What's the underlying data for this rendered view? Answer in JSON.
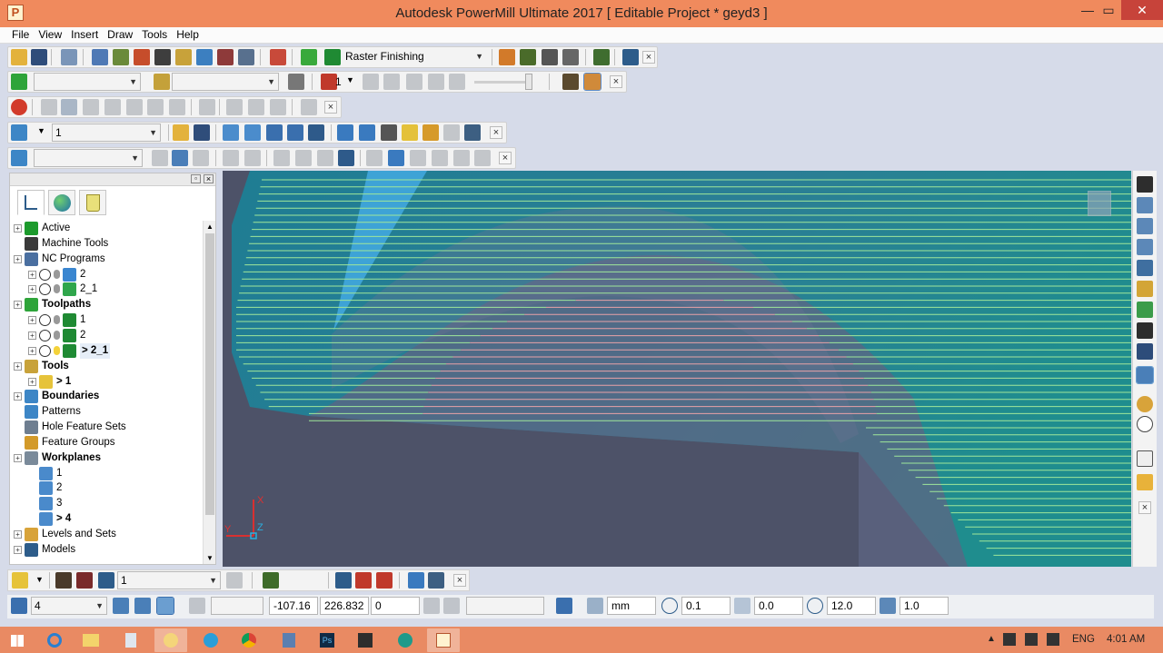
{
  "window": {
    "title": "Autodesk PowerMill Ultimate 2017    [ Editable Project * geyd3 ]",
    "app_icon_letter": "P",
    "buttons": {
      "minimize": "—",
      "maximize": "▭",
      "close": "✕"
    }
  },
  "menu": [
    "File",
    "View",
    "Insert",
    "Draw",
    "Tools",
    "Help"
  ],
  "toolbars": {
    "strategy_combo": "Raster Finishing",
    "row5_combo": "1",
    "row3_frame_value": "1"
  },
  "tree": {
    "items": [
      {
        "label": "Active",
        "bold": false
      },
      {
        "label": "Machine Tools",
        "bold": false
      },
      {
        "label": "NC Programs",
        "bold": false
      },
      {
        "label": "2",
        "bold": false
      },
      {
        "label": "2_1",
        "bold": false
      },
      {
        "label": "Toolpaths",
        "bold": true
      },
      {
        "label": "1",
        "bold": false
      },
      {
        "label": "2",
        "bold": false
      },
      {
        "label": "> 2_1",
        "bold": true
      },
      {
        "label": "Tools",
        "bold": true
      },
      {
        "label": "> 1",
        "bold": true
      },
      {
        "label": "Boundaries",
        "bold": true
      },
      {
        "label": "Patterns",
        "bold": false
      },
      {
        "label": "Hole Feature Sets",
        "bold": false
      },
      {
        "label": "Feature Groups",
        "bold": false
      },
      {
        "label": "Workplanes",
        "bold": true
      },
      {
        "label": "1",
        "bold": false
      },
      {
        "label": "2",
        "bold": false
      },
      {
        "label": "3",
        "bold": false
      },
      {
        "label": "> 4",
        "bold": true
      },
      {
        "label": "Levels and Sets",
        "bold": false
      },
      {
        "label": "Models",
        "bold": false
      }
    ]
  },
  "viewport": {
    "axis_x": "X",
    "axis_y": "Y",
    "axis_z": "Z"
  },
  "bottom": {
    "tool_combo": "1",
    "stock_combo": "4",
    "coord_x": "-107.16",
    "coord_y": "226.832",
    "coord_z": "0",
    "units": "mm",
    "tolerance": "0.1",
    "thickness": "0.0",
    "diameter": "12.0",
    "stepover": "1.0"
  },
  "taskbar": {
    "language": "ENG",
    "time": "4:01 AM"
  },
  "colors": {
    "titlebar": "#f08a5d",
    "taskbar": "#e98a63",
    "viewport_bg": "#4d5268",
    "toolpath_green": "#9fe79a",
    "toolpath_pink": "#e8a2a7"
  }
}
